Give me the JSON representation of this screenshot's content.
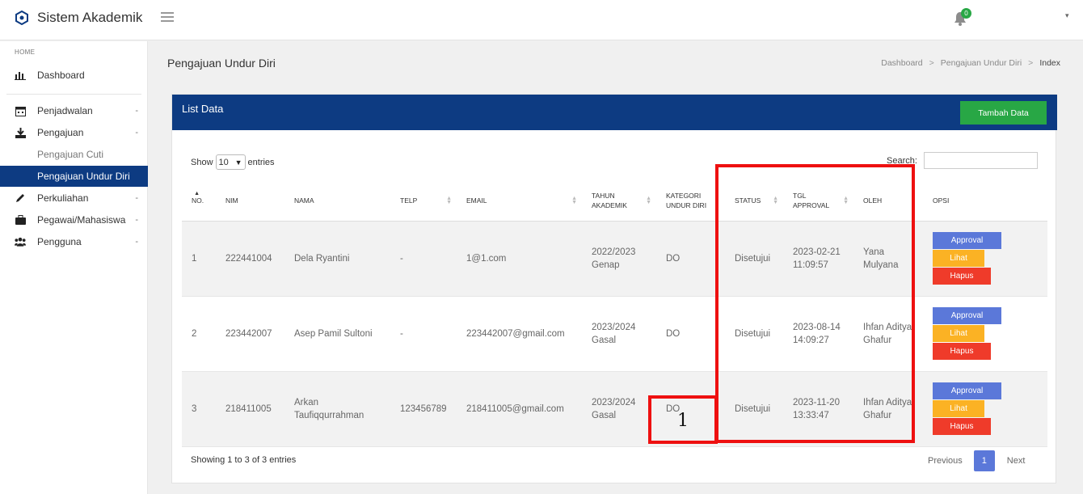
{
  "app": {
    "title": "Sistem Akademik",
    "notification_count": "0"
  },
  "sidebar": {
    "section_home": "HOME",
    "dashboard": "Dashboard",
    "items": [
      {
        "label": "Penjadwalan",
        "caret": "-"
      },
      {
        "label": "Pengajuan",
        "caret": "-"
      },
      {
        "label": "Perkuliahan",
        "caret": "-"
      },
      {
        "label": "Pegawai/Mahasiswa",
        "caret": "-"
      },
      {
        "label": "Pengguna",
        "caret": "-"
      }
    ],
    "sub_items": [
      {
        "label": "Pengajuan Cuti",
        "active": false
      },
      {
        "label": "Pengajuan Undur Diri",
        "active": true
      }
    ]
  },
  "page": {
    "title": "Pengajuan Undur Diri",
    "breadcrumb": [
      "Dashboard",
      "Pengajuan Undur Diri",
      "Index"
    ],
    "breadcrumb_sep": ">"
  },
  "card": {
    "title": "List Data",
    "add_button": "Tambah Data",
    "show_label": "Show",
    "entries_value": "10",
    "entries_label": "entries",
    "search_label": "Search:",
    "search_value": ""
  },
  "table": {
    "headers": [
      "NO.",
      "NIM",
      "NAMA",
      "TELP",
      "EMAIL",
      "TAHUN AKADEMIK",
      "KATEGORI UNDUR DIRI",
      "STATUS",
      "TGL APPROVAL",
      "OLEH",
      "OPSI"
    ],
    "rows": [
      {
        "no": "1",
        "nim": "222441004",
        "nama": "Dela Ryantini",
        "telp": "-",
        "email": "1@1.com",
        "tahun": "2022/2023 Genap",
        "kategori": "DO",
        "status": "Disetujui",
        "tgl": "2023-02-21 11:09:57",
        "oleh": "Yana Mulyana"
      },
      {
        "no": "2",
        "nim": "223442007",
        "nama": "Asep Pamil Sultoni",
        "telp": "-",
        "email": "223442007@gmail.com",
        "tahun": "2023/2024 Gasal",
        "kategori": "DO",
        "status": "Disetujui",
        "tgl": "2023-08-14 14:09:27",
        "oleh": "Ihfan Aditya Ghafur"
      },
      {
        "no": "3",
        "nim": "218411005",
        "nama": "Arkan Taufiqqurrahman",
        "telp": "123456789",
        "email": "218411005@gmail.com",
        "tahun": "2023/2024 Gasal",
        "kategori": "DO",
        "status": "Disetujui",
        "tgl": "2023-11-20 13:33:47",
        "oleh": "Ihfan Aditya Ghafur"
      }
    ],
    "actions": {
      "approval": "Approval",
      "lihat": "Lihat",
      "hapus": "Hapus"
    }
  },
  "footer": {
    "info": "Showing 1 to 3 of 3 entries",
    "previous": "Previous",
    "page": "1",
    "next": "Next"
  },
  "annotation": {
    "label": "1",
    "color": "#ee1010"
  }
}
